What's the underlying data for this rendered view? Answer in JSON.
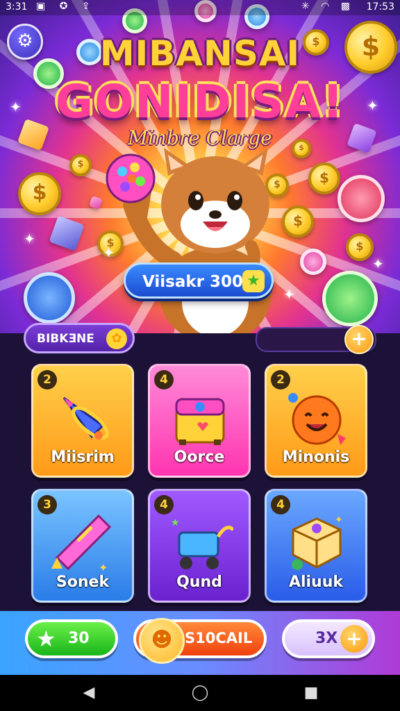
{
  "status_bar": {
    "time": "3:31",
    "left_icons": "▣ ✪ ⇪",
    "right_icons": "✳ ◠ ▩",
    "clock": "17:53"
  },
  "title_line1": "MIBANSAI",
  "title_line2": "GONIDISA!",
  "subtitle": "Minbre Clarge",
  "reward_pill": {
    "label": "Viisakr 300",
    "icon": "star-icon"
  },
  "progress_label": "BIBKƎNE",
  "tiles": [
    {
      "count": "2",
      "label": "Miisrim",
      "icon": "rocket-icon",
      "color": "#ffb02e"
    },
    {
      "count": "4",
      "label": "Oorce",
      "icon": "treasure-box-icon",
      "color": "#ff4fc0"
    },
    {
      "count": "2",
      "label": "Minonis",
      "icon": "smiley-ball-icon",
      "color": "#ffb02e"
    },
    {
      "count": "3",
      "label": "Sonek",
      "icon": "crayon-icon",
      "color": "#3a9cff"
    },
    {
      "count": "4",
      "label": "Qund",
      "icon": "cart-icon",
      "color": "#8a3ee0"
    },
    {
      "count": "4",
      "label": "Aliuuk",
      "icon": "cube-icon",
      "color": "#3a7cff"
    }
  ],
  "actions": {
    "green": "30",
    "orange": "S10CAIL",
    "purple": "3X"
  },
  "nav": {
    "back": "◀",
    "home": "◯",
    "recents": "■"
  }
}
